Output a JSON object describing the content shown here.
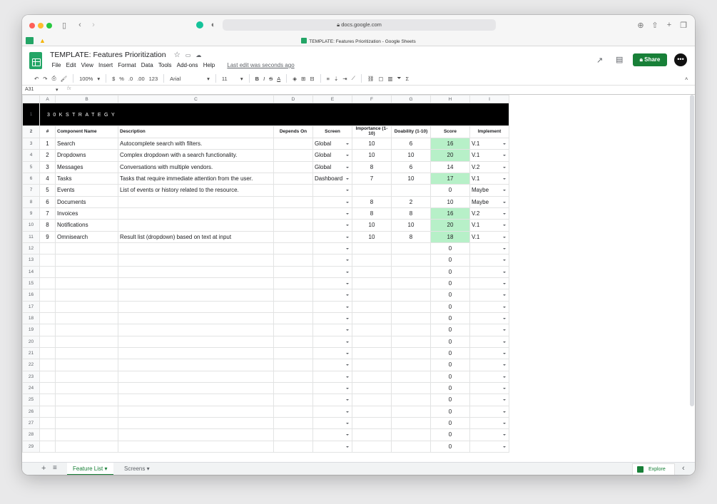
{
  "browser": {
    "url": "docs.google.com",
    "tab_title": "TEMPLATE: Features Prioritization - Google Sheets"
  },
  "doc": {
    "title": "TEMPLATE: Features Prioritization",
    "last_edit": "Last edit was seconds ago",
    "share_label": "Share"
  },
  "menu": [
    "File",
    "Edit",
    "View",
    "Insert",
    "Format",
    "Data",
    "Tools",
    "Add-ons",
    "Help"
  ],
  "toolbar": {
    "zoom": "100%",
    "currency": "$",
    "percent": "%",
    "dec_less": ".0",
    "dec_more": ".00",
    "format": "123",
    "font": "Arial",
    "size": "11"
  },
  "cell_ref": "A31",
  "formula_icon": "fx",
  "columns": [
    "A",
    "B",
    "C",
    "D",
    "E",
    "F",
    "G",
    "H",
    "I"
  ],
  "banner": "30KSTRATEGY",
  "headers": [
    "#",
    "Component Name",
    "Description",
    "Depends On",
    "Screen",
    "Importance (1-10)",
    "Doability (1-10)",
    "Score",
    "Implement"
  ],
  "rows": [
    {
      "n": "1",
      "name": "Search",
      "desc": "Autocomplete search with filters.",
      "screen": "Global",
      "imp": "10",
      "doa": "6",
      "score": "16",
      "impl": "V.1",
      "hi": true
    },
    {
      "n": "2",
      "name": "Dropdowns",
      "desc": "Complex dropdown with a search functionality.",
      "screen": "Global",
      "imp": "10",
      "doa": "10",
      "score": "20",
      "impl": "V.1",
      "hi": true
    },
    {
      "n": "3",
      "name": "Messages",
      "desc": "Conversations with multiple vendors.",
      "screen": "Global",
      "imp": "8",
      "doa": "6",
      "score": "14",
      "impl": "V.2",
      "hi": false
    },
    {
      "n": "4",
      "name": "Tasks",
      "desc": "Tasks that require immediate attention from the user.",
      "screen": "Dashboard",
      "imp": "7",
      "doa": "10",
      "score": "17",
      "impl": "V.1",
      "hi": true
    },
    {
      "n": "5",
      "name": "Events",
      "desc": "List of events or history related to the resource.",
      "screen": "",
      "imp": "",
      "doa": "",
      "score": "0",
      "impl": "Maybe",
      "hi": false
    },
    {
      "n": "6",
      "name": "Documents",
      "desc": "",
      "screen": "",
      "imp": "8",
      "doa": "2",
      "score": "10",
      "impl": "Maybe",
      "hi": false
    },
    {
      "n": "7",
      "name": "Invoices",
      "desc": "",
      "screen": "",
      "imp": "8",
      "doa": "8",
      "score": "16",
      "impl": "V.2",
      "hi": true
    },
    {
      "n": "8",
      "name": "Notifications",
      "desc": "",
      "screen": "",
      "imp": "10",
      "doa": "10",
      "score": "20",
      "impl": "V.1",
      "hi": true
    },
    {
      "n": "9",
      "name": "Omnisearch",
      "desc": "Result list (dropdown) based on text at input",
      "screen": "",
      "imp": "10",
      "doa": "8",
      "score": "18",
      "impl": "V.1",
      "hi": true
    }
  ],
  "empty_rows": [
    "12",
    "13",
    "14",
    "15",
    "16",
    "17",
    "18",
    "19",
    "20",
    "21",
    "22",
    "23",
    "24",
    "25",
    "26",
    "27",
    "28",
    "29"
  ],
  "empty_score": "0",
  "sheets": {
    "add": "+",
    "list": "≡",
    "active": "Feature List",
    "other": "Screens",
    "explore": "Explore"
  }
}
